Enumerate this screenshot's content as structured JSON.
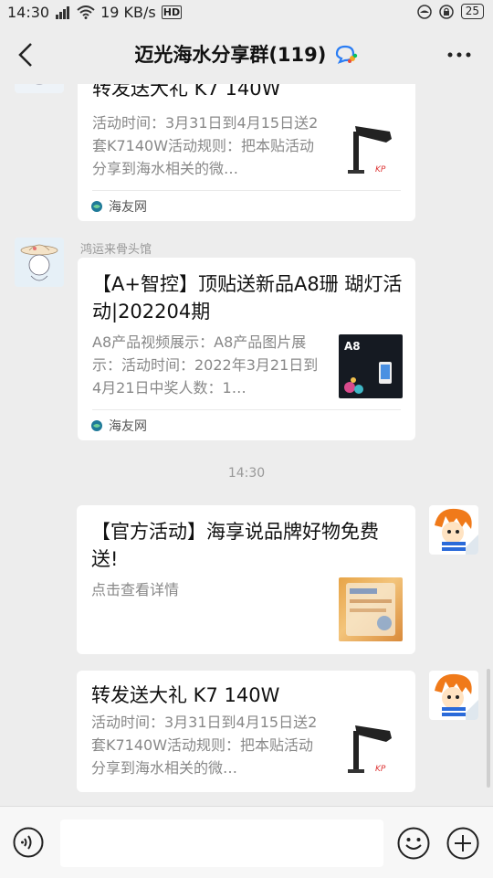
{
  "statusbar": {
    "time": "14:30",
    "speed": "19 KB/s",
    "battery": "25"
  },
  "header": {
    "title": "迈光海水分享群(119)"
  },
  "messages": [
    {
      "title": "转发送大礼 K7 140W",
      "desc": "活动时间：3月31日到4月15日送2套K7140W活动规则：把本贴活动分享到海水相关的微…",
      "source": "海友网"
    },
    {
      "sender": "鸿运来骨头馆",
      "title": "【A+智控】顶贴送新品A8珊 瑚灯活动|202204期",
      "desc": "A8产品视频展示：A8产品图片展示：活动时间：2022年3月21日到4月21日中奖人数：1…",
      "source": "海友网",
      "thumb_label": "A8"
    },
    {
      "timestamp": "14:30"
    },
    {
      "title": "【官方活动】海享说品牌好物免费送!",
      "desc": "点击查看详情"
    },
    {
      "title": "转发送大礼 K7 140W",
      "desc": "活动时间：3月31日到4月15日送2套K7140W活动规则：把本贴活动分享到海水相关的微…"
    }
  ],
  "colors": {
    "background": "#ededed",
    "card": "#ffffff",
    "muted": "#888888",
    "accent": "#07c160"
  }
}
